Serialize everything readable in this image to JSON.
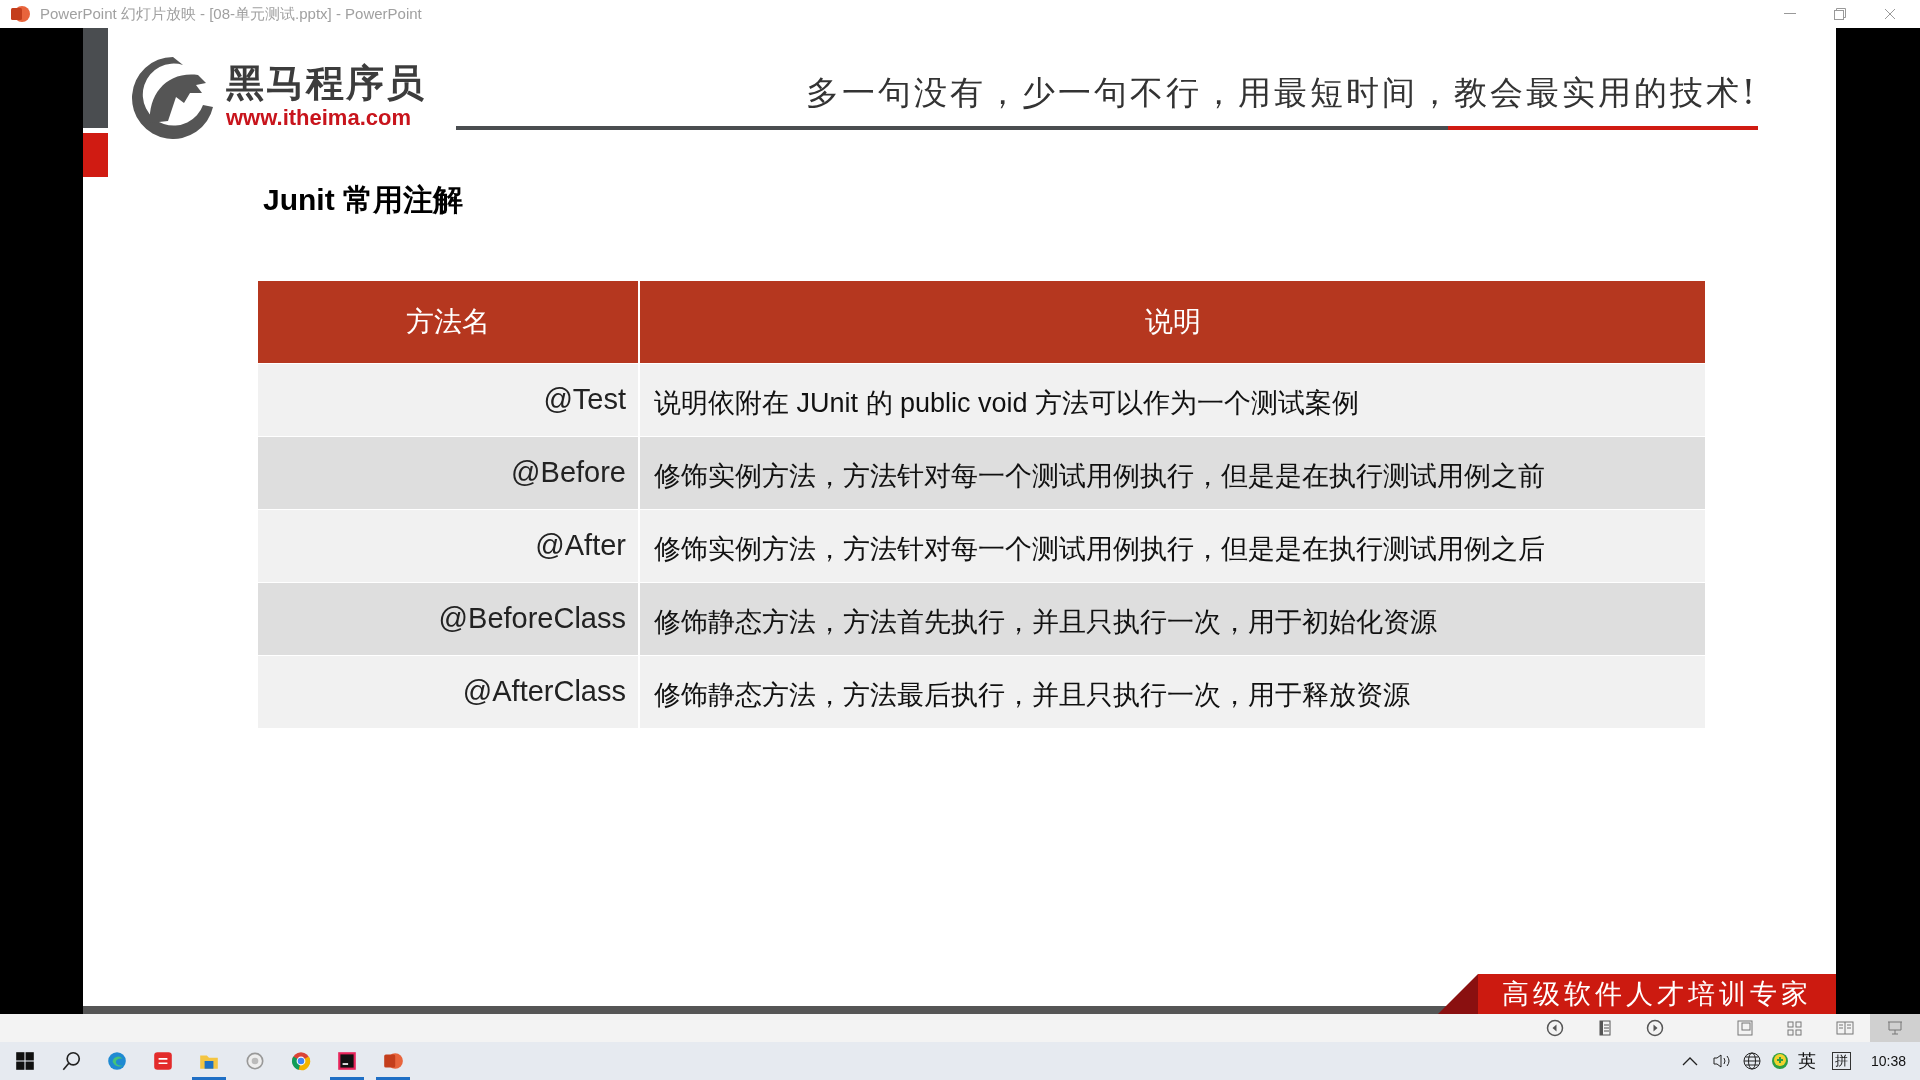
{
  "window": {
    "title": "PowerPoint 幻灯片放映 - [08-单元测试.pptx] - PowerPoint"
  },
  "slide": {
    "logo": {
      "name": "黑马程序员",
      "url": "www.itheima.com"
    },
    "slogan": "多一句没有，少一句不行，用最短时间，教会最实用的技术!",
    "heading": "Junit 常用注解",
    "table": {
      "columns": [
        "方法名",
        "说明"
      ],
      "rows": [
        {
          "cells": [
            "@Test",
            "说明依附在 JUnit 的 public void 方法可以作为一个测试案例"
          ]
        },
        {
          "cells": [
            "@Before",
            "修饰实例方法，方法针对每一个测试用例执行，但是是在执行测试用例之前"
          ]
        },
        {
          "cells": [
            "@After",
            "修饰实例方法，方法针对每一个测试用例执行，但是是在执行测试用例之后"
          ]
        },
        {
          "cells": [
            "@BeforeClass",
            "修饰静态方法，方法首先执行，并且只执行一次，用于初始化资源"
          ]
        },
        {
          "cells": [
            "@AfterClass",
            "修饰静态方法，方法最后执行，并且只执行一次，用于释放资源"
          ]
        }
      ]
    },
    "footer": "高级软件人才培训专家"
  },
  "status_bar": {
    "buttons": [
      {
        "kind": "prev",
        "selected": false
      },
      {
        "kind": "notes",
        "selected": false
      },
      {
        "kind": "next",
        "selected": false
      },
      {
        "kind": "normal",
        "selected": false
      },
      {
        "kind": "sorter",
        "selected": false
      },
      {
        "kind": "reading",
        "selected": false
      },
      {
        "kind": "slideshow",
        "selected": true
      }
    ]
  },
  "taskbar": {
    "apps": [
      {
        "kind": "start",
        "running": false
      },
      {
        "kind": "search",
        "running": false
      },
      {
        "kind": "edge",
        "running": false
      },
      {
        "kind": "red-app",
        "running": false
      },
      {
        "kind": "explorer",
        "running": true
      },
      {
        "kind": "circle-app",
        "running": false
      },
      {
        "kind": "chrome",
        "running": false
      },
      {
        "kind": "intellij",
        "running": true
      },
      {
        "kind": "powerpoint",
        "running": true
      }
    ],
    "tray": {
      "ime": "英",
      "ime_mode": "拼",
      "clock": "10:38"
    }
  }
}
